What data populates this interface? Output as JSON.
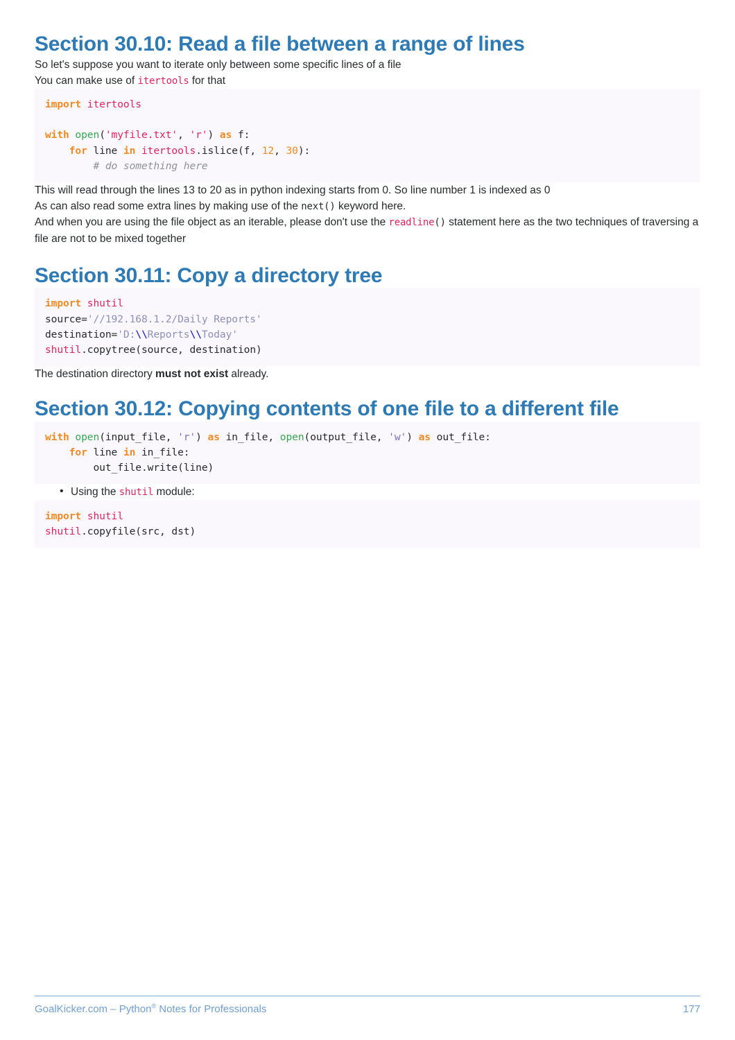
{
  "document": {
    "footer": {
      "site": "GoalKicker.com",
      "separator": " – ",
      "title_pre": "Python",
      "registered_mark": "®",
      "title_post": " Notes for Professionals",
      "full_text": "GoalKicker.com – Python® Notes for Professionals",
      "page_number": "177"
    },
    "colors": {
      "heading_blue": "#2e7ab5",
      "footer_blue": "#6f9fd0",
      "footer_rule": "#7fa9d0",
      "code_background": "#faf8fc",
      "body_text": "#26292c",
      "keyword_orange": "#f08a24",
      "module_pink": "#e0245e",
      "function_green": "#36a552",
      "string_muted_blue": "#8b90b8",
      "escape_blue": "#2c34c7",
      "string_violet": "#7d6fbd",
      "comment_gray": "#8e9296"
    }
  },
  "sections": [
    {
      "heading": "Section 30.10: Read a file between a range of lines",
      "paragraph_1": "So let's suppose you want to iterate only between some specific lines of a file",
      "paragraph_2_pre": "You can make use of ",
      "paragraph_2_code": "itertools",
      "paragraph_2_post": " for that",
      "code": {
        "line_1_kw": "import",
        "line_1_mod": " itertools",
        "line_3_kw": "with",
        "line_3_fn": " open",
        "line_3_p1": "(",
        "line_3_str1": "'myfile.txt'",
        "line_3_p2": ", ",
        "line_3_str2": "'r'",
        "line_3_p3": ") ",
        "line_3_as": "as",
        "line_3_p4": " f:",
        "line_4_indent": "    ",
        "line_4_for": "for",
        "line_4_p1": " line ",
        "line_4_in": "in",
        "line_4_mod": " itertools",
        "line_4_p2": ".islice(f, ",
        "line_4_num1": "12",
        "line_4_p3": ", ",
        "line_4_num2": "30",
        "line_4_p4": "):",
        "line_5_indent": "        ",
        "line_5_comment": "# do something here"
      },
      "paragraph_3": "This will read through the lines 13 to 20 as in python indexing starts from 0. So line number 1 is indexed as 0",
      "paragraph_4_pre": "As can also read some extra lines by making use of the ",
      "paragraph_4_code": "next()",
      "paragraph_4_post": " keyword here.",
      "paragraph_5_pre": "And when you are using the file object as an iterable, please don't use the ",
      "paragraph_5_code_mod": "readline",
      "paragraph_5_code_plain": "()",
      "paragraph_5_post": " statement here as the two techniques of traversing a file are not to be mixed together"
    },
    {
      "heading": "Section 30.11: Copy a directory tree",
      "code": {
        "line_1_kw": "import",
        "line_1_mod": " shutil",
        "line_2_name": "source=",
        "line_2_str": "'//192.168.1.2/Daily Reports'",
        "line_3_name": "destination=",
        "line_3_str_a": "'D:",
        "line_3_esc_a": "\\\\",
        "line_3_str_b": "Reports",
        "line_3_esc_b": "\\\\",
        "line_3_str_c": "Today'",
        "line_4_mod": "shutil",
        "line_4_rest": ".copytree(source, destination)"
      },
      "paragraph_1_pre": "The destination directory ",
      "paragraph_1_bold": "must not exist",
      "paragraph_1_post": " already."
    },
    {
      "heading": "Section 30.12: Copying contents of one file to a different file",
      "code_1": {
        "line_1_kw": "with",
        "line_1_fn1": " open",
        "line_1_p1": "(input_file, ",
        "line_1_str1": "'r'",
        "line_1_p2": ") ",
        "line_1_as1": "as",
        "line_1_p3": " in_file, ",
        "line_1_fn2": "open",
        "line_1_p4": "(output_file, ",
        "line_1_str2": "'w'",
        "line_1_p5": ") ",
        "line_1_as2": "as",
        "line_1_p6": " out_file:",
        "line_2_indent": "    ",
        "line_2_for": "for",
        "line_2_p1": " line ",
        "line_2_in": "in",
        "line_2_p2": " in_file:",
        "line_3_indent": "        ",
        "line_3_text": "out_file.write(line)"
      },
      "bullet_1_pre": "Using the ",
      "bullet_1_code": "shutil",
      "bullet_1_post": " module:",
      "code_2": {
        "line_1_kw": "import",
        "line_1_mod": " shutil",
        "line_2_mod": "shutil",
        "line_2_rest": ".copyfile(src, dst)"
      }
    }
  ]
}
